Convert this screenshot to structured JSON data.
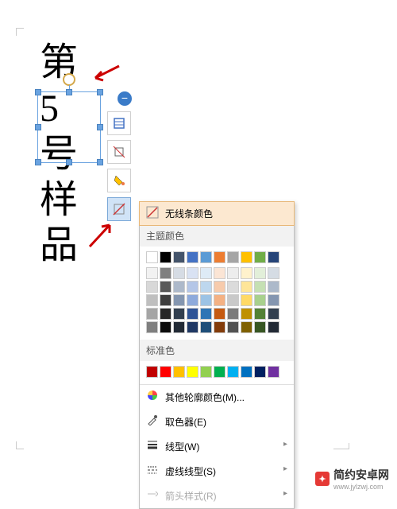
{
  "vertical_chars": [
    "第",
    "5",
    "号",
    "样",
    "品"
  ],
  "toolbar": {
    "layout_options": "布局",
    "crop": "裁剪",
    "fill": "填充",
    "outline": "轮廓"
  },
  "menu": {
    "no_line_color": "无线条颜色",
    "theme_colors_label": "主题颜色",
    "standard_colors_label": "标准色",
    "more_colors": "其他轮廓颜色(M)...",
    "eyedropper": "取色器(E)",
    "line_style": "线型(W)",
    "dash_style": "虚线线型(S)",
    "arrow_style": "箭头样式(R)"
  },
  "colors": {
    "theme_row1": [
      "#ffffff",
      "#000000",
      "#44546a",
      "#4472c4",
      "#5b9bd5",
      "#ed7d31",
      "#a5a5a5",
      "#ffc000",
      "#70ad47",
      "#264478"
    ],
    "theme_shades": [
      [
        "#f2f2f2",
        "#7f7f7f",
        "#d6dce4",
        "#d9e2f3",
        "#deebf6",
        "#fbe5d5",
        "#ededed",
        "#fff2cc",
        "#e2efd9",
        "#d5dce4"
      ],
      [
        "#d8d8d8",
        "#595959",
        "#adb9ca",
        "#b4c6e7",
        "#bdd7ee",
        "#f7cbac",
        "#dbdbdb",
        "#fee599",
        "#c5e0b3",
        "#acb9ca"
      ],
      [
        "#bfbfbf",
        "#3f3f3f",
        "#8496b0",
        "#8eaadb",
        "#9cc3e5",
        "#f4b183",
        "#c9c9c9",
        "#ffd965",
        "#a8d08d",
        "#8496b0"
      ],
      [
        "#a5a5a5",
        "#262626",
        "#323f4f",
        "#2f5496",
        "#2e75b5",
        "#c55a11",
        "#7b7b7b",
        "#bf9000",
        "#538135",
        "#323f4f"
      ],
      [
        "#7f7f7f",
        "#0c0c0c",
        "#222a35",
        "#1f3864",
        "#1e4e79",
        "#833c0b",
        "#525252",
        "#7f6000",
        "#375623",
        "#222a35"
      ]
    ],
    "standard": [
      "#c00000",
      "#ff0000",
      "#ffc000",
      "#ffff00",
      "#92d050",
      "#00b050",
      "#00b0f0",
      "#0070c0",
      "#002060",
      "#7030a0"
    ]
  },
  "watermark": {
    "text": "简约安卓网",
    "url": "www.jylzwj.com"
  }
}
